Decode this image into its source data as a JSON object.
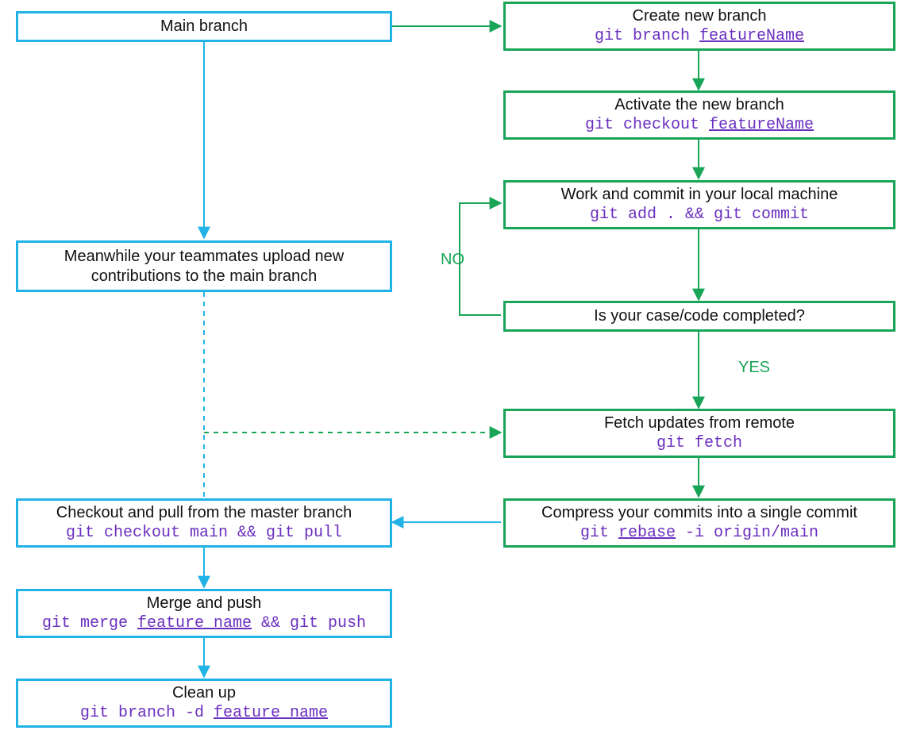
{
  "colors": {
    "blue": "#22b3e6",
    "green": "#18a558",
    "cmd": "#6a2fbf"
  },
  "labels": {
    "no": "NO",
    "yes": "YES"
  },
  "nodes": {
    "main": {
      "title": "Main branch"
    },
    "meanwhile": {
      "line1": "Meanwhile your teammates upload new",
      "line2": "contributions to the main branch"
    },
    "checkout": {
      "title": "Checkout and pull from the master branch",
      "cmd": "git checkout main && git pull"
    },
    "merge": {
      "title": "Merge and push",
      "cmd_p1": "git merge ",
      "cmd_u": "feature_name",
      "cmd_p2": " && git push"
    },
    "cleanup": {
      "title": "Clean up",
      "cmd_p1": "git branch -d ",
      "cmd_u": "feature_name"
    },
    "create": {
      "title": "Create new branch",
      "cmd_p1": "git branch ",
      "cmd_u": "featureName"
    },
    "activate": {
      "title": "Activate the new branch",
      "cmd_p1": "git checkout ",
      "cmd_u": "featureName"
    },
    "work": {
      "title": "Work and commit in your local machine",
      "cmd": "git add . && git commit"
    },
    "completed": {
      "title": "Is your case/code completed?"
    },
    "fetch": {
      "title": "Fetch updates from remote",
      "cmd": "git fetch"
    },
    "compress": {
      "title": "Compress your commits into a single commit",
      "cmd_p1": "git ",
      "cmd_u": "rebase",
      "cmd_p2": " -i origin/main"
    }
  }
}
